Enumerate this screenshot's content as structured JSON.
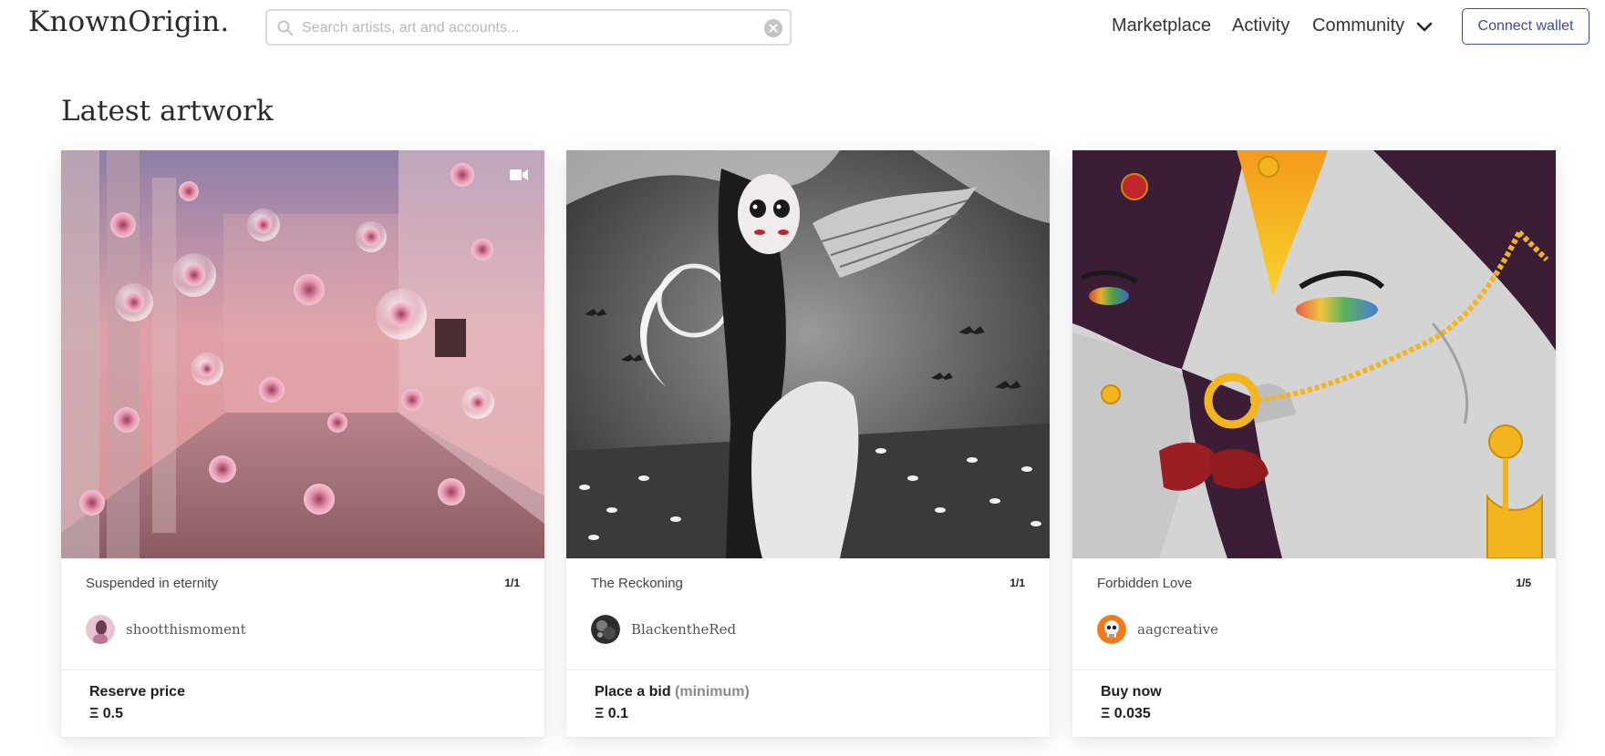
{
  "header": {
    "logo": "KnownOrigin.",
    "search_placeholder": "Search artists, art and accounts...",
    "nav": {
      "marketplace": "Marketplace",
      "activity": "Activity",
      "community": "Community"
    },
    "connect_label": "Connect wallet"
  },
  "section": {
    "title": "Latest artwork"
  },
  "cards": [
    {
      "title": "Suspended in eternity",
      "edition": "1/1",
      "artist": "shootthismoment",
      "price_label": "Reserve price",
      "price_qualifier": "",
      "price_value": "Ξ 0.5",
      "media_icon": "video-camera-icon"
    },
    {
      "title": "The Reckoning",
      "edition": "1/1",
      "artist": "BlackentheRed",
      "price_label": "Place a bid",
      "price_qualifier": "(minimum)",
      "price_value": "Ξ 0.1"
    },
    {
      "title": "Forbidden Love",
      "edition": "1/5",
      "artist": "aagcreative",
      "price_label": "Buy now",
      "price_qualifier": "",
      "price_value": "Ξ 0.035"
    }
  ],
  "colors": {
    "accent": "#3d4a9e",
    "text": "#1e1e1e",
    "muted": "#8a8a8a"
  }
}
